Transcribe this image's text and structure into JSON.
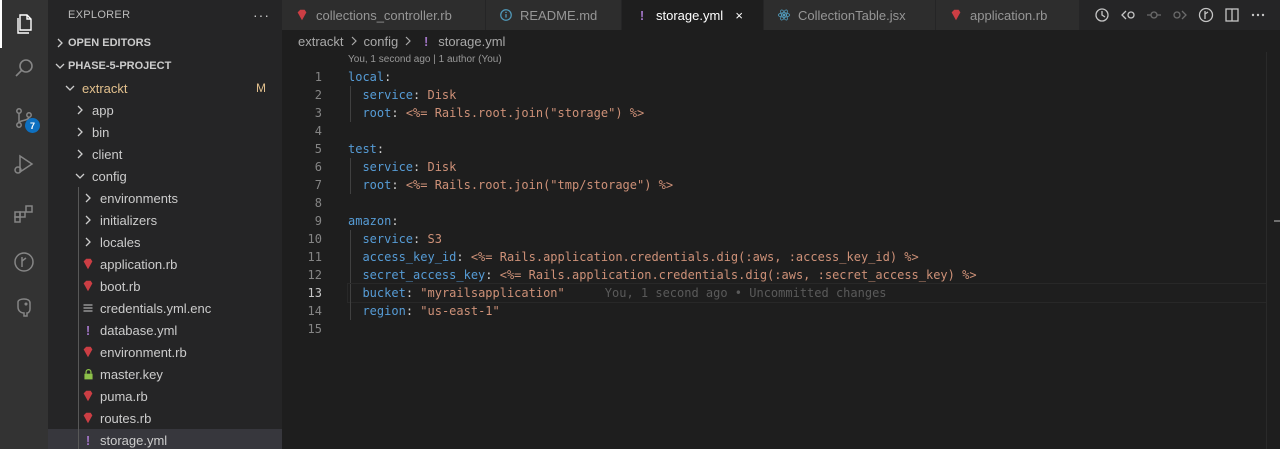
{
  "sidebar": {
    "title": "EXPLORER",
    "more": "···",
    "open_editors": "OPEN EDITORS",
    "project": "PHASE-5-PROJECT",
    "root": {
      "name": "extrackt",
      "badge": "M"
    },
    "folders": [
      "app",
      "bin",
      "client",
      "config"
    ],
    "config_children": [
      "environments",
      "initializers",
      "locales"
    ],
    "files": [
      {
        "name": "application.rb",
        "icon": "ruby-icon"
      },
      {
        "name": "boot.rb",
        "icon": "ruby-icon"
      },
      {
        "name": "credentials.yml.enc",
        "icon": "lines-icon"
      },
      {
        "name": "database.yml",
        "icon": "yaml-icon"
      },
      {
        "name": "environment.rb",
        "icon": "ruby-icon"
      },
      {
        "name": "master.key",
        "icon": "lock-icon"
      },
      {
        "name": "puma.rb",
        "icon": "ruby-icon"
      },
      {
        "name": "routes.rb",
        "icon": "ruby-icon"
      },
      {
        "name": "storage.yml",
        "icon": "yaml-icon"
      }
    ]
  },
  "activity": {
    "source_control_badge": "7"
  },
  "tabs": [
    {
      "label": "collections_controller.rb",
      "icon": "ruby-icon"
    },
    {
      "label": "README.md",
      "icon": "info-icon"
    },
    {
      "label": "storage.yml",
      "icon": "yaml-icon",
      "close": "×"
    },
    {
      "label": "CollectionTable.jsx",
      "icon": "react-icon"
    },
    {
      "label": "application.rb",
      "icon": "ruby-icon"
    }
  ],
  "breadcrumb": [
    "extrackt",
    "config",
    "storage.yml"
  ],
  "editor": {
    "codelens": "You, 1 second ago | 1 author (You)",
    "current_line": 13,
    "blame": "You, 1 second ago • Uncommitted changes",
    "lines": [
      {
        "n": "1",
        "key": "local",
        "colon": ":",
        "indent": "",
        "val": ""
      },
      {
        "n": "2",
        "key": "service",
        "colon": ": ",
        "indent": "  ",
        "val": "Disk"
      },
      {
        "n": "3",
        "key": "root",
        "colon": ": ",
        "indent": "  ",
        "val": "<%= Rails.root.join(\"storage\") %>"
      },
      {
        "n": "4",
        "key": "",
        "colon": "",
        "indent": "",
        "val": ""
      },
      {
        "n": "5",
        "key": "test",
        "colon": ":",
        "indent": "",
        "val": ""
      },
      {
        "n": "6",
        "key": "service",
        "colon": ": ",
        "indent": "  ",
        "val": "Disk"
      },
      {
        "n": "7",
        "key": "root",
        "colon": ": ",
        "indent": "  ",
        "val": "<%= Rails.root.join(\"tmp/storage\") %>"
      },
      {
        "n": "8",
        "key": "",
        "colon": "",
        "indent": "",
        "val": ""
      },
      {
        "n": "9",
        "key": "amazon",
        "colon": ":",
        "indent": "",
        "val": ""
      },
      {
        "n": "10",
        "key": "service",
        "colon": ": ",
        "indent": "  ",
        "val": "S3"
      },
      {
        "n": "11",
        "key": "access_key_id",
        "colon": ": ",
        "indent": "  ",
        "val": "<%= Rails.application.credentials.dig(:aws, :access_key_id) %>"
      },
      {
        "n": "12",
        "key": "secret_access_key",
        "colon": ": ",
        "indent": "  ",
        "val": "<%= Rails.application.credentials.dig(:aws, :secret_access_key) %>"
      },
      {
        "n": "13",
        "key": "bucket",
        "colon": ": ",
        "indent": "  ",
        "val": "\"myrailsapplication\""
      },
      {
        "n": "14",
        "key": "region",
        "colon": ": ",
        "indent": "  ",
        "val": "\"us-east-1\""
      },
      {
        "n": "15",
        "key": "",
        "colon": "",
        "indent": "",
        "val": ""
      }
    ]
  },
  "colors": {
    "ruby": "#cc3e44",
    "yaml": "#a074c4",
    "lock": "#8dc149",
    "info": "#519aba",
    "react": "#519aba",
    "modified": "#e2c08d"
  }
}
